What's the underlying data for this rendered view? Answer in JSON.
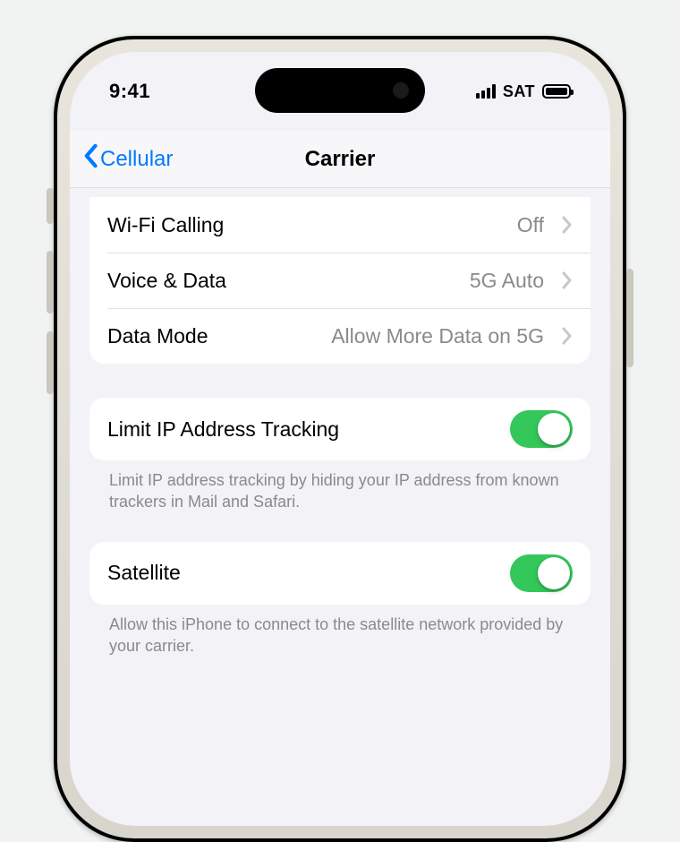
{
  "status": {
    "time": "9:41",
    "network_label": "SAT"
  },
  "nav": {
    "back_label": "Cellular",
    "title": "Carrier"
  },
  "group_carrier": {
    "rows": [
      {
        "label": "Wi-Fi Calling",
        "value": "Off"
      },
      {
        "label": "Voice & Data",
        "value": "5G Auto"
      },
      {
        "label": "Data Mode",
        "value": "Allow More Data on 5G"
      }
    ]
  },
  "group_ip": {
    "label": "Limit IP Address Tracking",
    "toggle_on": true,
    "footer": "Limit IP address tracking by hiding your IP address from known trackers in Mail and Safari."
  },
  "group_sat": {
    "label": "Satellite",
    "toggle_on": true,
    "footer": "Allow this iPhone to connect to the satellite network provided by your carrier."
  }
}
